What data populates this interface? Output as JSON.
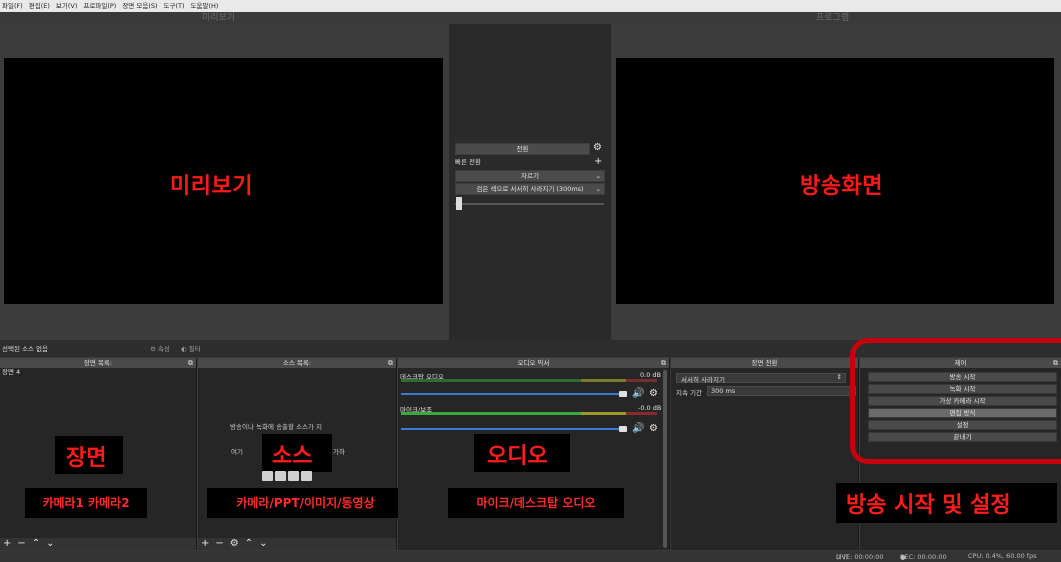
{
  "menu": [
    "파일(F)",
    "편집(E)",
    "보기(V)",
    "프로파일(P)",
    "장면 모음(S)",
    "도구(T)",
    "도움말(H)"
  ],
  "preview": {
    "label": "미리보기",
    "annotation": "미리보기"
  },
  "program": {
    "label": "프로그램",
    "annotation": "방송화면"
  },
  "transitions": {
    "transition_button": "전환",
    "quick_transitions_label": "빠른 전환",
    "cut_option": "자르기",
    "fade_option": "검은 색으로 서서히 사라지기 (300ms)"
  },
  "properties_bar": {
    "no_source": "선택된 소스 없음",
    "properties_tab": "속성",
    "filters_tab": "필터"
  },
  "docks": {
    "scenes": {
      "title": "장면 목록:",
      "items": [
        "장면 4"
      ],
      "annotation": "장면",
      "sub_annotation": "카메라1 카메라2"
    },
    "sources": {
      "title": "소스 목록:",
      "hint_line1": "방송이나 녹화에 송출할 소스가 지",
      "hint_line2_left": "여기",
      "hint_line2_right": "가하",
      "annotation": "소스",
      "sub_annotation": "카메라/PPT/이미지/동영상"
    },
    "mixer": {
      "title": "오디오 믹서",
      "channels": [
        {
          "name": "데스크탑 오디오",
          "level": "0.0 dB"
        },
        {
          "name": "마이크/보조",
          "level": "-0.0 dB"
        }
      ],
      "annotation": "오디오",
      "sub_annotation": "마이크/데스크탑 오디오"
    },
    "scene_transitions": {
      "title": "장면 전환",
      "selected": "서서히 사라지기",
      "duration_label": "지속 기간",
      "duration_value": "300 ms"
    },
    "controls": {
      "title": "제어",
      "buttons": [
        "방송 시작",
        "녹화 시작",
        "가상 카메라 시작",
        "편집 방식",
        "설정",
        "끝내기"
      ],
      "annotation": "방송 시작 및 설정"
    }
  },
  "statusbar": {
    "live": "LIVE: 00:00:00",
    "rec": "REC: 00:00:00",
    "cpu": "CPU: 0.4%, 60.00 fps"
  },
  "colors": {
    "annotation_red": "#ff1a1a",
    "frame_red": "#c8000a",
    "slider_blue": "#3b7ad6"
  }
}
